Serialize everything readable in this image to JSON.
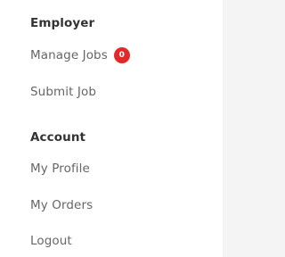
{
  "sidebar": {
    "employer": {
      "title": "Employer",
      "items": [
        {
          "label": "Manage Jobs",
          "badge": "0"
        },
        {
          "label": "Submit Job"
        }
      ]
    },
    "account": {
      "title": "Account",
      "items": [
        {
          "label": "My Profile"
        },
        {
          "label": "My Orders"
        },
        {
          "label": "Logout"
        }
      ]
    }
  },
  "colors": {
    "badge": "#e02a2a",
    "heading": "#333333",
    "item": "#666666",
    "background": "#f4f4f4"
  }
}
